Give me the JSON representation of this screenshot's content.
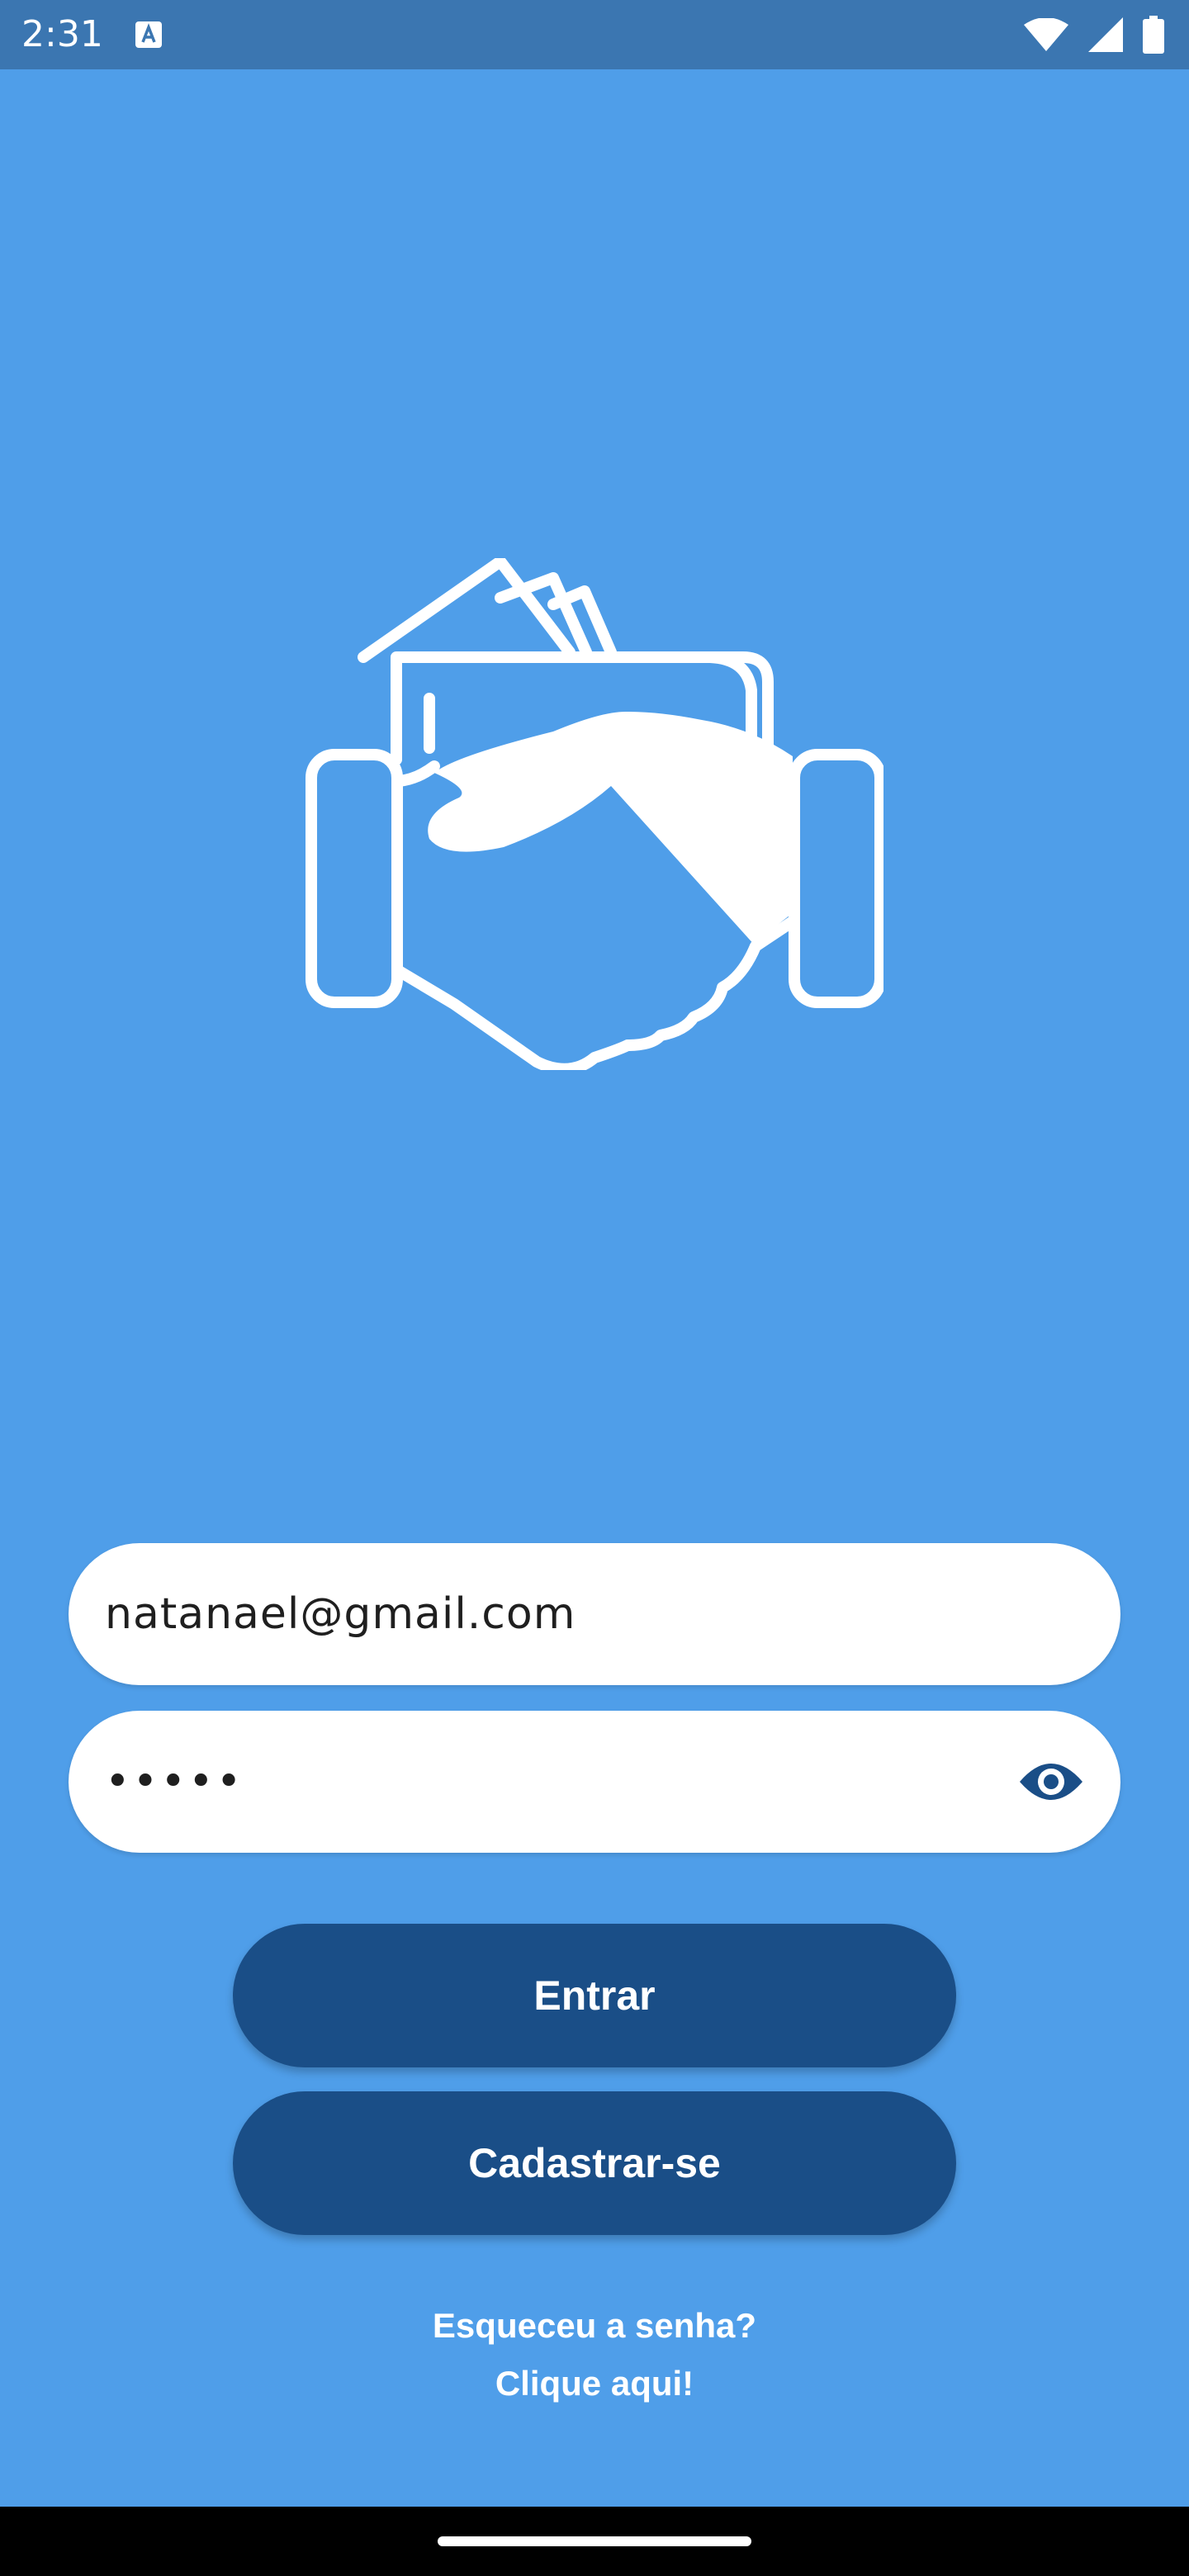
{
  "status_bar": {
    "time": "2:31",
    "icons": [
      "app-notification-icon",
      "wifi-icon",
      "signal-icon",
      "battery-icon"
    ]
  },
  "logo": {
    "icon": "handshake-wallet-logo"
  },
  "login_form": {
    "email_value": "natanael@gmail.com",
    "password_value": "•••••",
    "password_toggle_icon": "eye-icon"
  },
  "buttons": {
    "login_label": "Entrar",
    "register_label": "Cadastrar-se"
  },
  "forgot_password": {
    "line1": "Esqueceu a senha?",
    "line2": "Clique aqui!"
  },
  "colors": {
    "background": "#4f9ee9",
    "status_bar": "#3b76b1",
    "button": "#1a4e87",
    "field": "#ffffff",
    "eye_icon": "#1a4e87"
  }
}
